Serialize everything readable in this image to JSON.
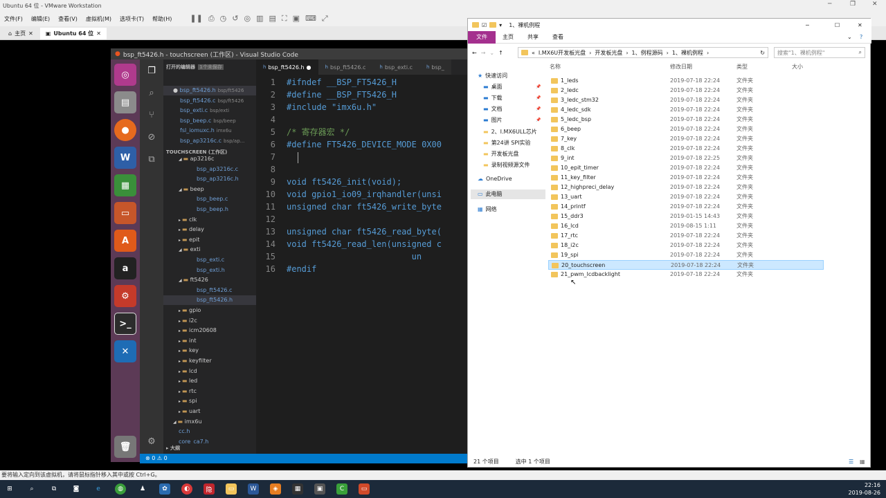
{
  "vmware": {
    "title": "Ubuntu 64 位 - VMware Workstation",
    "menu": [
      "文件(F)",
      "编辑(E)",
      "查看(V)",
      "虚拟机(M)",
      "选项卡(T)",
      "帮助(H)"
    ],
    "tabs": [
      {
        "label": "主页"
      },
      {
        "label": "Ubuntu 64 位"
      }
    ],
    "status_hint": "要将输入定向到该虚拟机，请将鼠标指针移入其中或按 Ctrl+G。"
  },
  "vscode": {
    "title": "bsp_ft5426.h - touchscreen (工作区) - Visual Studio Code",
    "open_editors_header": "打开的编辑器",
    "unsaved_badge": "1个未保存",
    "open_editors": [
      {
        "name": "bsp_ft5426.h",
        "path": "bsp/ft5426"
      },
      {
        "name": "bsp_ft5426.c",
        "path": "bsp/ft5426"
      },
      {
        "name": "bsp_exti.c",
        "path": "bsp/exti"
      },
      {
        "name": "bsp_beep.c",
        "path": "bsp/beep"
      },
      {
        "name": "fsl_iomuxc.h",
        "path": "imx6u"
      },
      {
        "name": "bsp_ap3216c.c",
        "path": "bsp/ap..."
      }
    ],
    "workspace_header": "TOUCHSCREEN (工作区)",
    "tree": [
      {
        "label": "ap3216c",
        "type": "folder-open",
        "indent": 1
      },
      {
        "label": "bsp_ap3216c.c",
        "type": "file",
        "indent": 2
      },
      {
        "label": "bsp_ap3216c.h",
        "type": "file",
        "indent": 2
      },
      {
        "label": "beep",
        "type": "folder-open",
        "indent": 1
      },
      {
        "label": "bsp_beep.c",
        "type": "file",
        "indent": 2
      },
      {
        "label": "bsp_beep.h",
        "type": "file",
        "indent": 2
      },
      {
        "label": "clk",
        "type": "folder",
        "indent": 1
      },
      {
        "label": "delay",
        "type": "folder",
        "indent": 1
      },
      {
        "label": "epit",
        "type": "folder",
        "indent": 1
      },
      {
        "label": "exti",
        "type": "folder-open",
        "indent": 1
      },
      {
        "label": "bsp_exti.c",
        "type": "file",
        "indent": 2
      },
      {
        "label": "bsp_exti.h",
        "type": "file",
        "indent": 2
      },
      {
        "label": "ft5426",
        "type": "folder-open",
        "indent": 1
      },
      {
        "label": "bsp_ft5426.c",
        "type": "file",
        "indent": 2
      },
      {
        "label": "bsp_ft5426.h",
        "type": "file",
        "indent": 2,
        "selected": true
      },
      {
        "label": "gpio",
        "type": "folder",
        "indent": 1
      },
      {
        "label": "i2c",
        "type": "folder",
        "indent": 1
      },
      {
        "label": "icm20608",
        "type": "folder",
        "indent": 1
      },
      {
        "label": "int",
        "type": "folder",
        "indent": 1
      },
      {
        "label": "key",
        "type": "folder",
        "indent": 1
      },
      {
        "label": "keyfilter",
        "type": "folder",
        "indent": 1
      },
      {
        "label": "lcd",
        "type": "folder",
        "indent": 1
      },
      {
        "label": "led",
        "type": "folder",
        "indent": 1
      },
      {
        "label": "rtc",
        "type": "folder",
        "indent": 1
      },
      {
        "label": "spi",
        "type": "folder",
        "indent": 1
      },
      {
        "label": "uart",
        "type": "folder",
        "indent": 1
      },
      {
        "label": "imx6u",
        "type": "folder-open",
        "indent": 0
      },
      {
        "label": "cc.h",
        "type": "file",
        "indent": 1
      },
      {
        "label": "core_ca7.h",
        "type": "file",
        "indent": 1
      }
    ],
    "outline_header": "大纲",
    "editor_tabs": [
      {
        "label": "bsp_ft5426.h",
        "dirty": true
      },
      {
        "label": "bsp_ft5426.c"
      },
      {
        "label": "bsp_exti.c"
      },
      {
        "label": "bsp_"
      }
    ],
    "code": [
      {
        "n": "1",
        "text": "#ifndef __BSP_FT5426_H"
      },
      {
        "n": "2",
        "text": "#define __BSP_FT5426_H"
      },
      {
        "n": "3",
        "text": "#include \"imx6u.h\""
      },
      {
        "n": "4",
        "text": ""
      },
      {
        "n": "5",
        "text": "/* 寄存器宏 */"
      },
      {
        "n": "6",
        "text": "#define FT5426_DEVICE_MODE 0X00"
      },
      {
        "n": "7",
        "text": ""
      },
      {
        "n": "8",
        "text": ""
      },
      {
        "n": "9",
        "text": "void ft5426_init(void);"
      },
      {
        "n": "10",
        "text": "void gpio1_io09_irqhandler(unsi"
      },
      {
        "n": "11",
        "text": "unsigned char ft5426_write_byte"
      },
      {
        "n": "12",
        "text": ""
      },
      {
        "n": "13",
        "text": "unsigned char ft5426_read_byte("
      },
      {
        "n": "14",
        "text": "void ft5426_read_len(unsigned c"
      },
      {
        "n": "15",
        "text": "                         un"
      },
      {
        "n": "16",
        "text": "#endif"
      }
    ],
    "status": "⊗ 0 ⚠ 0"
  },
  "explorer": {
    "title": "1、裸机例程",
    "ribbon": [
      "文件",
      "主页",
      "共享",
      "查看"
    ],
    "breadcrumb": [
      "I.MX6U开发板光盘",
      "开发板光盘",
      "1、例程源码",
      "1、裸机例程"
    ],
    "search_placeholder": "搜索\"1、裸机例程\"",
    "columns": {
      "name": "名称",
      "date": "修改日期",
      "type": "类型",
      "size": "大小"
    },
    "nav": [
      {
        "label": "快速访问",
        "kind": "star"
      },
      {
        "label": "桌面",
        "kind": "blue",
        "pin": true
      },
      {
        "label": "下载",
        "kind": "blue",
        "pin": true
      },
      {
        "label": "文档",
        "kind": "blue",
        "pin": true
      },
      {
        "label": "图片",
        "kind": "blue",
        "pin": true
      },
      {
        "label": "2、I.MX6ULL芯片",
        "kind": "folder"
      },
      {
        "label": "第24讲 SPI实验",
        "kind": "folder"
      },
      {
        "label": "开发板光盘",
        "kind": "folder"
      },
      {
        "label": "录制视频源文件",
        "kind": "folder"
      },
      {
        "label": "OneDrive",
        "kind": "cloud"
      },
      {
        "label": "此电脑",
        "kind": "pc",
        "selected": true
      },
      {
        "label": "网络",
        "kind": "net"
      }
    ],
    "files": [
      {
        "name": "1_leds",
        "date": "2019-07-18 22:24",
        "type": "文件夹"
      },
      {
        "name": "2_ledc",
        "date": "2019-07-18 22:24",
        "type": "文件夹"
      },
      {
        "name": "3_ledc_stm32",
        "date": "2019-07-18 22:24",
        "type": "文件夹"
      },
      {
        "name": "4_ledc_sdk",
        "date": "2019-07-18 22:24",
        "type": "文件夹"
      },
      {
        "name": "5_ledc_bsp",
        "date": "2019-07-18 22:24",
        "type": "文件夹"
      },
      {
        "name": "6_beep",
        "date": "2019-07-18 22:24",
        "type": "文件夹"
      },
      {
        "name": "7_key",
        "date": "2019-07-18 22:24",
        "type": "文件夹"
      },
      {
        "name": "8_clk",
        "date": "2019-07-18 22:24",
        "type": "文件夹"
      },
      {
        "name": "9_int",
        "date": "2019-07-18 22:25",
        "type": "文件夹"
      },
      {
        "name": "10_epit_timer",
        "date": "2019-07-18 22:24",
        "type": "文件夹"
      },
      {
        "name": "11_key_filter",
        "date": "2019-07-18 22:24",
        "type": "文件夹"
      },
      {
        "name": "12_highpreci_delay",
        "date": "2019-07-18 22:24",
        "type": "文件夹"
      },
      {
        "name": "13_uart",
        "date": "2019-07-18 22:24",
        "type": "文件夹"
      },
      {
        "name": "14_printf",
        "date": "2019-07-18 22:24",
        "type": "文件夹"
      },
      {
        "name": "15_ddr3",
        "date": "2019-01-15 14:43",
        "type": "文件夹"
      },
      {
        "name": "16_lcd",
        "date": "2019-08-15 1:11",
        "type": "文件夹"
      },
      {
        "name": "17_rtc",
        "date": "2019-07-18 22:24",
        "type": "文件夹"
      },
      {
        "name": "18_i2c",
        "date": "2019-07-18 22:24",
        "type": "文件夹"
      },
      {
        "name": "19_spi",
        "date": "2019-07-18 22:24",
        "type": "文件夹"
      },
      {
        "name": "20_touchscreen",
        "date": "2019-07-18 22:24",
        "type": "文件夹",
        "selected": true
      },
      {
        "name": "21_pwm_lcdbacklight",
        "date": "2019-07-18 22:24",
        "type": "文件夹"
      }
    ],
    "status_count": "21 个项目",
    "status_selected": "选中 1 个项目"
  },
  "taskbar": {
    "time": "22:16",
    "date": "2019-08-26"
  }
}
